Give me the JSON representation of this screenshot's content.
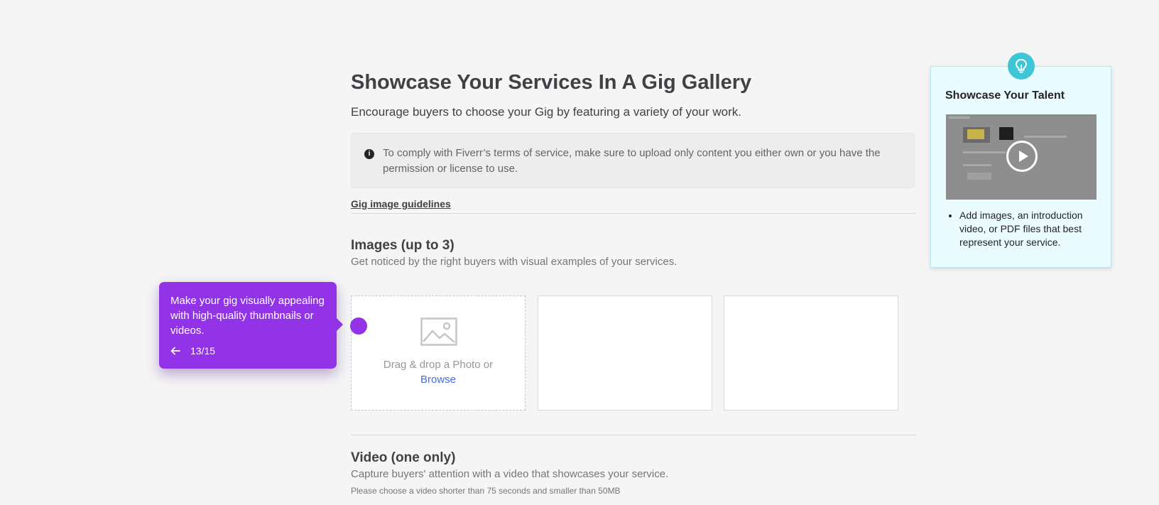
{
  "main": {
    "title": "Showcase Your Services In A Gig Gallery",
    "subtitle": "Encourage buyers to choose your Gig by featuring a variety of your work.",
    "notice": "To comply with Fiverr’s terms of service, make sure to upload only content you either own or you have the permission or license to use.",
    "guidelines_link": "Gig image guidelines",
    "images": {
      "title": "Images (up to 3)",
      "desc": "Get noticed by the right buyers with visual examples of your services.",
      "drop_text": "Drag & drop a Photo or",
      "browse": "Browse"
    },
    "video": {
      "title": "Video (one only)",
      "desc": "Capture buyers' attention with a video that showcases your service.",
      "note": "Please choose a video shorter than 75 seconds and smaller than 50MB"
    }
  },
  "tooltip": {
    "text": "Make your gig visually appealing with high-quality thumbnails or videos.",
    "step": "13/15"
  },
  "side_panel": {
    "title": "Showcase Your Talent",
    "tip": "Add images, an introduction video, or PDF files that best represent your service."
  },
  "colors": {
    "accent_purple": "#9333e8",
    "panel_bg": "#eafcff",
    "link_blue": "#446ee7",
    "bulb_teal": "#3ec6d6"
  }
}
